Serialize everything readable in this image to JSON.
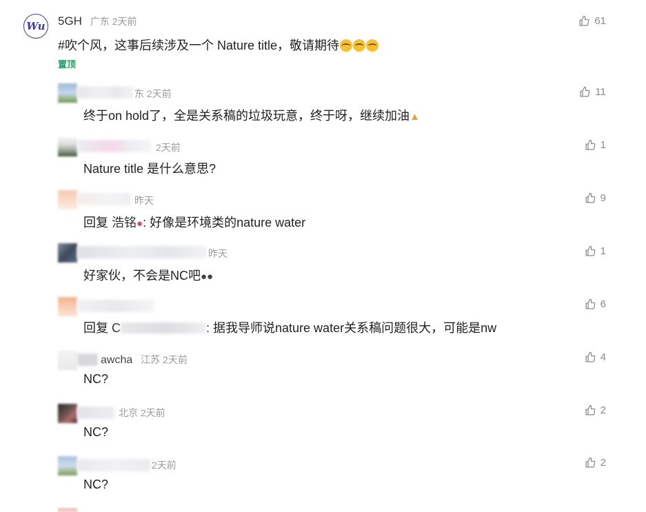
{
  "comments": [
    {
      "user": "5GH",
      "location": "广东",
      "time": "2天前",
      "text": "#吹个风，这事后续涉及一个 Nature title，敬请期待",
      "pin": "置顶",
      "likes": "61",
      "avatar_text": "Wu"
    },
    {
      "user": "",
      "location": "东",
      "time": "2天前",
      "text": "终于on hold了，全是关系稿的垃圾玩意，终于呀，继续加油",
      "likes": "11"
    },
    {
      "user": "",
      "location": "",
      "time": "2天前",
      "text": "Nature title 是什么意思?",
      "likes": "1"
    },
    {
      "user": "",
      "location": "",
      "time": "昨天",
      "text_prefix": "回复",
      "mention": "浩铭",
      "text": ": 好像是环境类的nature water",
      "likes": "9"
    },
    {
      "user": "",
      "location": "",
      "time": "昨天",
      "text": "好家伙，不会是NC吧",
      "likes": "1"
    },
    {
      "user": "",
      "location": "",
      "time": "",
      "text_prefix": "回复",
      "mention": "C",
      "text": ": 据我导师说nature water关系稿问题很大，可能是nw",
      "likes": "6"
    },
    {
      "user": "awcha",
      "location": "江苏",
      "time": "2天前",
      "text": "NC?",
      "likes": "4"
    },
    {
      "user": "",
      "location": "北京",
      "time": "2天前",
      "text": "NC?",
      "likes": "2"
    },
    {
      "user": "",
      "location": "",
      "time": "2天前",
      "text": "NC?",
      "likes": "2"
    }
  ],
  "colors": {
    "pin": "#1aa260",
    "meta": "#9b9b9b",
    "like": "#8a8a8a"
  },
  "icons": {
    "like": "thumbs-up-icon"
  }
}
